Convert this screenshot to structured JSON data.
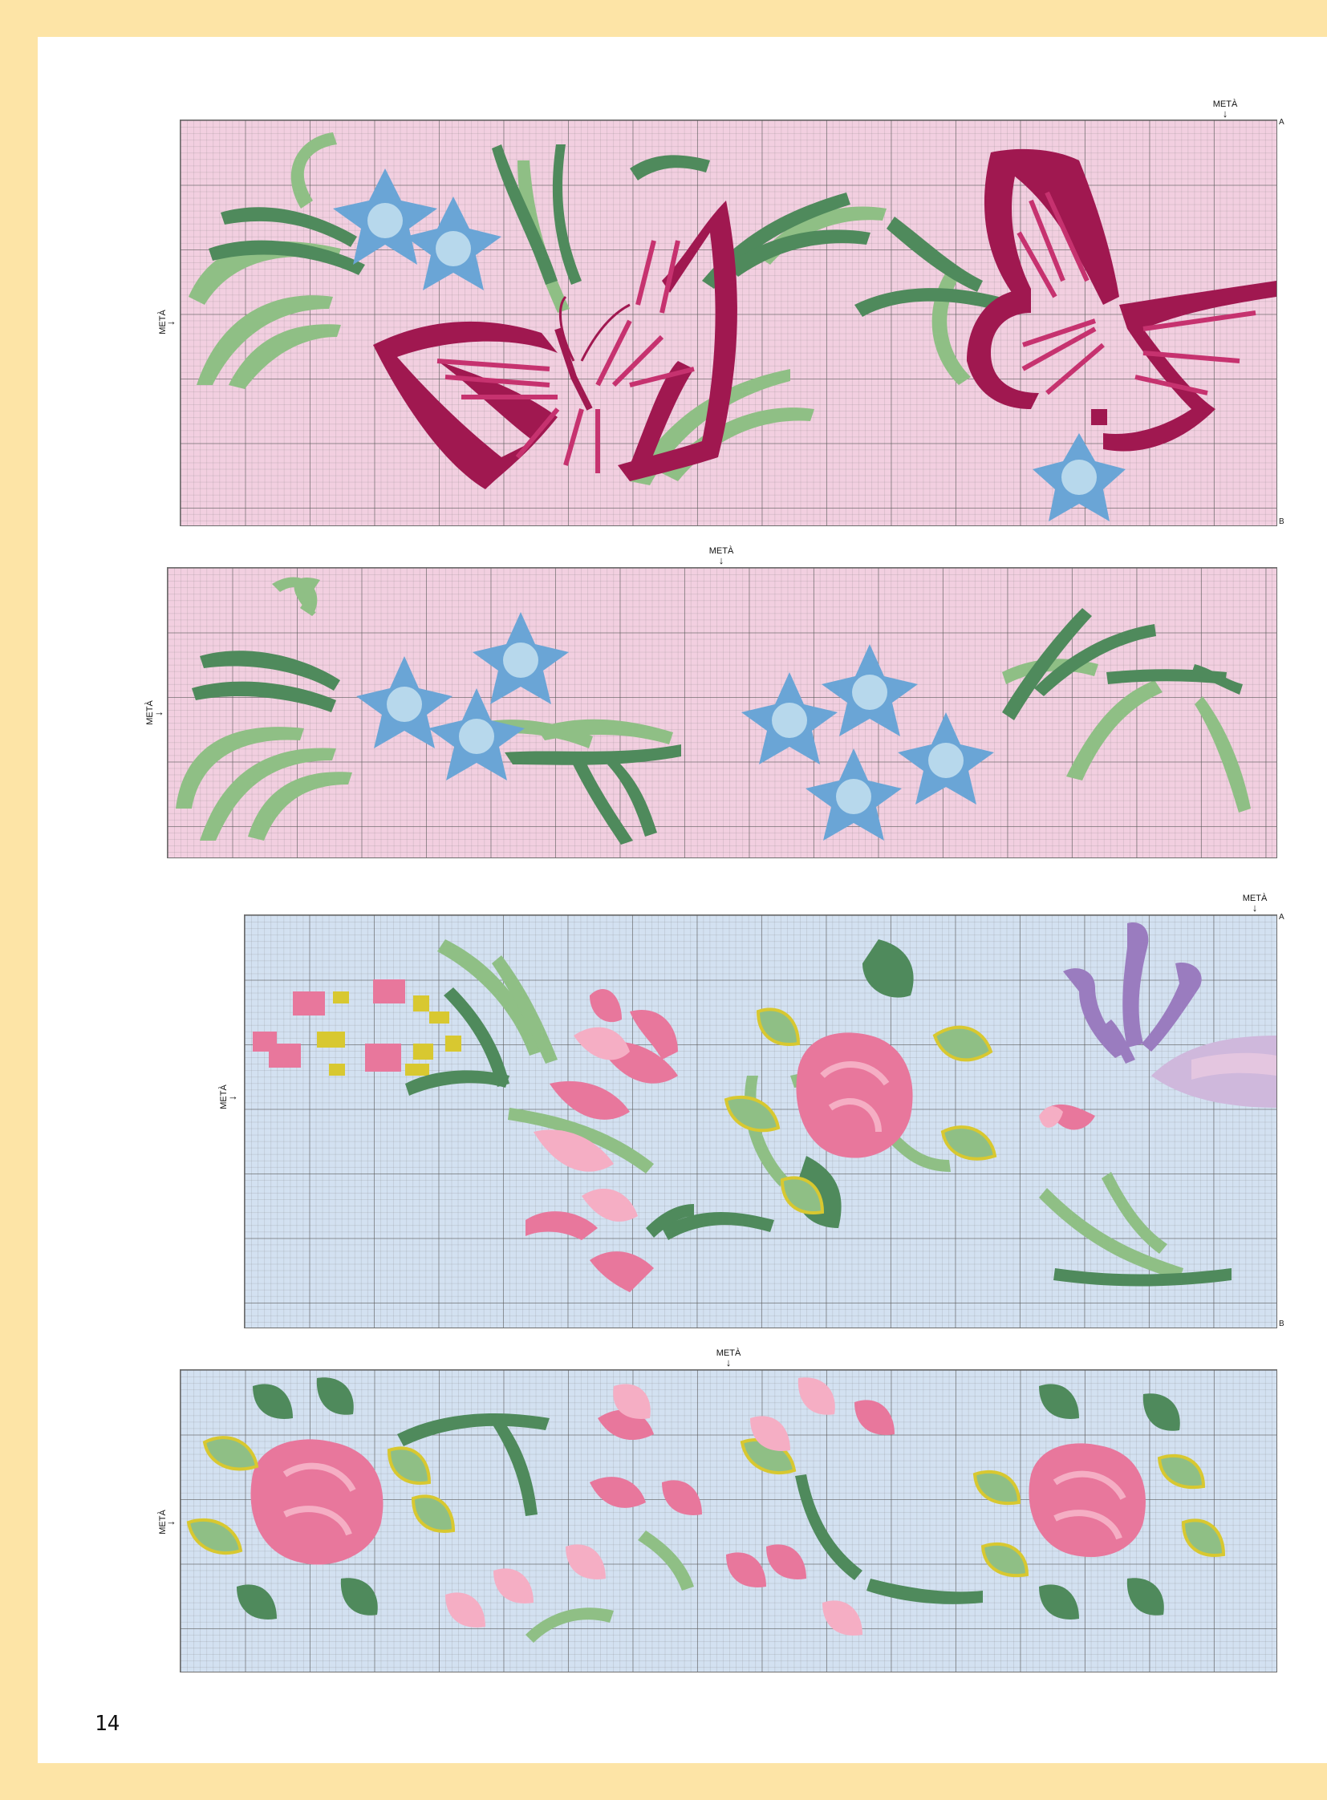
{
  "page": {
    "number": "14"
  },
  "marker": {
    "label": "METÀ"
  },
  "corners": {
    "a": "A",
    "b": "B"
  },
  "charts": [
    {
      "id": "chart-1",
      "theme": "butterflies-and-bellflowers",
      "background": "#f2cfe0",
      "has_corner_labels": true
    },
    {
      "id": "chart-2",
      "theme": "bellflowers-and-leaves",
      "background": "#f2cfe0",
      "has_corner_labels": false
    },
    {
      "id": "chart-3",
      "theme": "roses-and-iris",
      "background": "#d3e1f1",
      "has_corner_labels": true
    },
    {
      "id": "chart-4",
      "theme": "roses-and-tulips",
      "background": "#d3e1f1",
      "has_corner_labels": false
    }
  ],
  "colors": {
    "butterfly_dark": "#a01850",
    "butterfly_mid": "#c6326f",
    "leaf_dark": "#4f8a5c",
    "leaf_light": "#8fbf85",
    "bellflower_outer": "#6aa5d6",
    "bellflower_inner": "#b7d8ec",
    "rose_pink": "#e8779c",
    "rose_light": "#f5aec4",
    "leaf_yellow": "#d8c830",
    "iris_purple": "#9a7cbf",
    "iris_light": "#cfb8dc"
  }
}
